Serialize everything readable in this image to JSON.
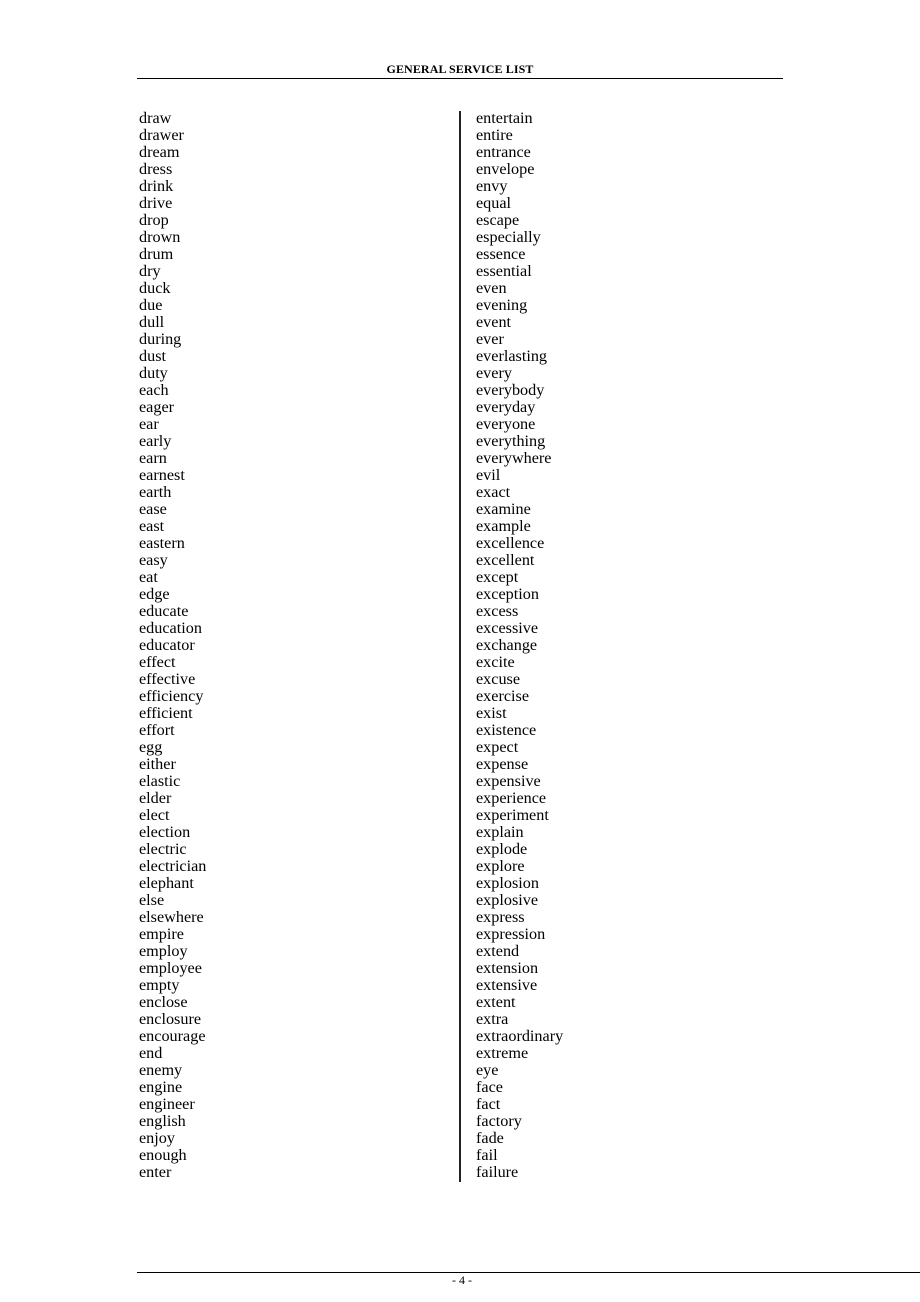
{
  "header": {
    "title": "GENERAL SERVICE LIST"
  },
  "columns": {
    "left": [
      "draw",
      "drawer",
      "dream",
      "dress",
      "drink",
      "drive",
      "drop",
      "drown",
      "drum",
      "dry",
      "duck",
      "due",
      "dull",
      "during",
      "dust",
      "duty",
      "each",
      "eager",
      "ear",
      "early",
      "earn",
      "earnest",
      "earth",
      "ease",
      "east",
      "eastern",
      "easy",
      "eat",
      "edge",
      "educate",
      "education",
      "educator",
      "effect",
      "effective",
      "efficiency",
      "efficient",
      "effort",
      "egg",
      "either",
      "elastic",
      "elder",
      "elect",
      "election",
      "electric",
      "electrician",
      "elephant",
      "else",
      "elsewhere",
      "empire",
      "employ",
      "employee",
      "empty",
      "enclose",
      "enclosure",
      "encourage",
      "end",
      "enemy",
      "engine",
      "engineer",
      "english",
      "enjoy",
      "enough",
      "enter"
    ],
    "right": [
      "entertain",
      "entire",
      "entrance",
      "envelope",
      "envy",
      "equal",
      "escape",
      "especially",
      "essence",
      "essential",
      "even",
      "evening",
      "event",
      "ever",
      "everlasting",
      "every",
      "everybody",
      "everyday",
      "everyone",
      "everything",
      "everywhere",
      "evil",
      "exact",
      "examine",
      "example",
      "excellence",
      "excellent",
      "except",
      "exception",
      "excess",
      "excessive",
      "exchange",
      "excite",
      "excuse",
      "exercise",
      "exist",
      "existence",
      "expect",
      "expense",
      "expensive",
      "experience",
      "experiment",
      "explain",
      "explode",
      "explore",
      "explosion",
      "explosive",
      "express",
      "expression",
      "extend",
      "extension",
      "extensive",
      "extent",
      "extra",
      "extraordinary",
      "extreme",
      "eye",
      "face",
      "fact",
      "factory",
      "fade",
      "fail",
      "failure"
    ]
  },
  "footer": {
    "page_number": "- 4 -"
  }
}
